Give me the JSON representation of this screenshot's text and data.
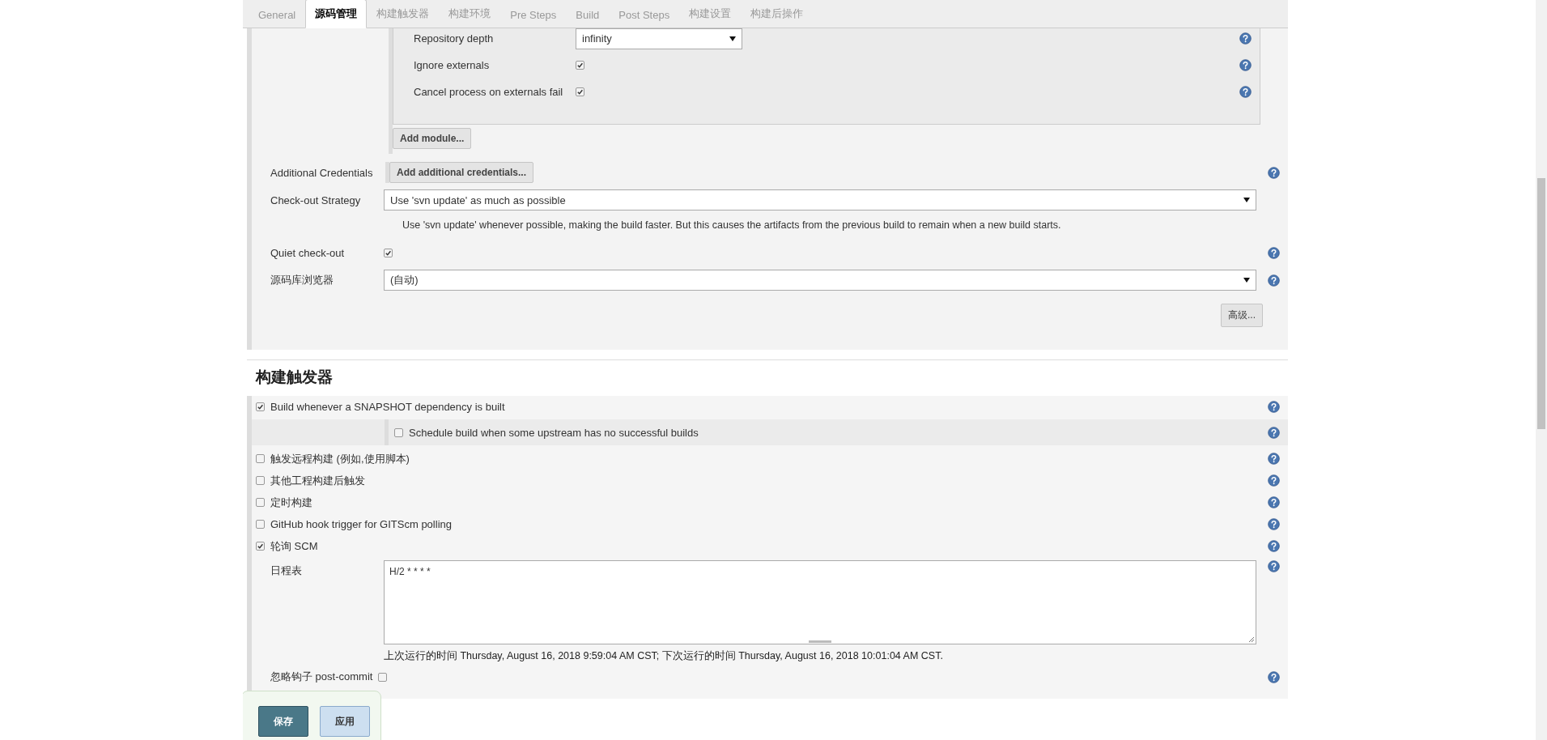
{
  "tabs": [
    {
      "label": "General",
      "selected": false
    },
    {
      "label": "源码管理",
      "selected": true
    },
    {
      "label": "构建触发器",
      "selected": false
    },
    {
      "label": "构建环境",
      "selected": false
    },
    {
      "label": "Pre Steps",
      "selected": false
    },
    {
      "label": "Build",
      "selected": false
    },
    {
      "label": "Post Steps",
      "selected": false
    },
    {
      "label": "构建设置",
      "selected": false
    },
    {
      "label": "构建后操作",
      "selected": false
    }
  ],
  "scm": {
    "module_options": [
      {
        "kind": "select",
        "label": "Repository depth",
        "value": "infinity"
      },
      {
        "kind": "checkbox",
        "label": "Ignore externals",
        "checked": true
      },
      {
        "kind": "checkbox",
        "label": "Cancel process on externals fail",
        "checked": true
      }
    ],
    "add_module_button": "Add module...",
    "additional_credentials": {
      "label": "Additional Credentials",
      "button": "Add additional credentials..."
    },
    "checkout_strategy": {
      "label": "Check-out Strategy",
      "value": "Use 'svn update' as much as possible",
      "description": "Use 'svn update' whenever possible, making the build faster. But this causes the artifacts from the previous build to remain when a new build starts."
    },
    "quiet_checkout": {
      "label": "Quiet check-out",
      "checked": true
    },
    "repository_browser": {
      "label": "源码库浏览器",
      "value": "(自动)"
    },
    "advanced_button": "高级..."
  },
  "triggers": {
    "heading": "构建触发器",
    "items": [
      {
        "label": "Build whenever a SNAPSHOT dependency is built",
        "checked": true,
        "children": [
          {
            "label": "Schedule build when some upstream has no successful builds",
            "checked": false
          }
        ]
      },
      {
        "label": "触发远程构建 (例如,使用脚本)",
        "checked": false
      },
      {
        "label": "其他工程构建后触发",
        "checked": false
      },
      {
        "label": "定时构建",
        "checked": false
      },
      {
        "label": "GitHub hook trigger for GITScm polling",
        "checked": false
      },
      {
        "label": "轮询 SCM",
        "checked": true
      }
    ],
    "schedule": {
      "label": "日程表",
      "value": "H/2 * * * *",
      "run_times": "上次运行的时间 Thursday, August 16, 2018 9:59:04 AM CST; 下次运行的时间 Thursday, August 16, 2018 10:01:04 AM CST."
    },
    "ignore_post_commit": {
      "label": "忽略钩子 post-commit",
      "checked": false
    }
  },
  "buttons": {
    "save": "保存",
    "apply": "应用"
  }
}
